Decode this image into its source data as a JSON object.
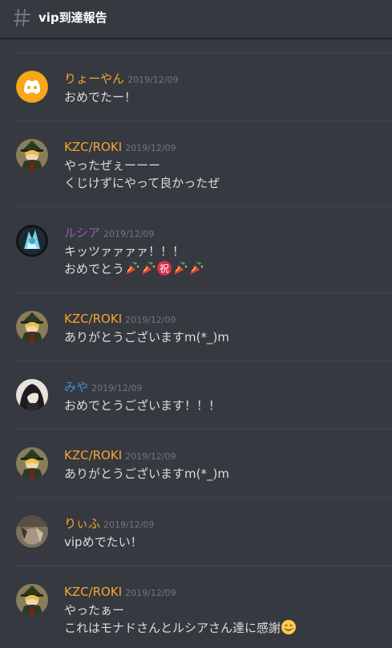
{
  "channel": {
    "name": "vip到達報告",
    "icon": "hash-icon"
  },
  "colors": {
    "background": "#36393f",
    "text": "#dcddde",
    "timestamp": "#72767d",
    "orange": "#f8a532",
    "purple": "#9b59b6",
    "blue": "#3e8ed0"
  },
  "messages": [
    {
      "author": "りょーやん",
      "author_color": "#f8a532",
      "avatar": "discord-default-avatar",
      "timestamp": "2019/12/09",
      "lines": [
        "おめでたー！"
      ]
    },
    {
      "author": "KZC/ROKI",
      "author_color": "#f8a532",
      "avatar": "kzc-roki-avatar",
      "timestamp": "2019/12/09",
      "lines": [
        "やったぜぇーーー",
        "くじけずにやって良かったぜ"
      ]
    },
    {
      "author": "ルシア",
      "author_color": "#9b59b6",
      "avatar": "lucia-avatar",
      "timestamp": "2019/12/09",
      "lines": [
        "キッツァァァァ！！！",
        "おめでとう"
      ],
      "emojis": [
        "confetti-emoji",
        "confetti-emoji",
        "celebration-emoji",
        "confetti-emoji",
        "confetti-emoji"
      ]
    },
    {
      "author": "KZC/ROKI",
      "author_color": "#f8a532",
      "avatar": "kzc-roki-avatar",
      "timestamp": "2019/12/09",
      "lines": [
        "ありがとうございますm(*_)m"
      ]
    },
    {
      "author": "みや",
      "author_color": "#3e8ed0",
      "avatar": "miya-avatar",
      "timestamp": "2019/12/09",
      "lines": [
        "おめでとうございます！！！"
      ]
    },
    {
      "author": "KZC/ROKI",
      "author_color": "#f8a532",
      "avatar": "kzc-roki-avatar",
      "timestamp": "2019/12/09",
      "lines": [
        "ありがとうございますm(*_)m"
      ]
    },
    {
      "author": "りぃふ",
      "author_color": "#f8a532",
      "avatar": "riifu-avatar",
      "timestamp": "2019/12/09",
      "lines": [
        "vipめでたい！"
      ]
    },
    {
      "author": "KZC/ROKI",
      "author_color": "#f8a532",
      "avatar": "kzc-roki-avatar",
      "timestamp": "2019/12/09",
      "lines": [
        "やったぁー",
        "これはモナドさんとルシアさん達に感謝"
      ],
      "emojis": [
        "smiling-face-emoji"
      ]
    }
  ]
}
